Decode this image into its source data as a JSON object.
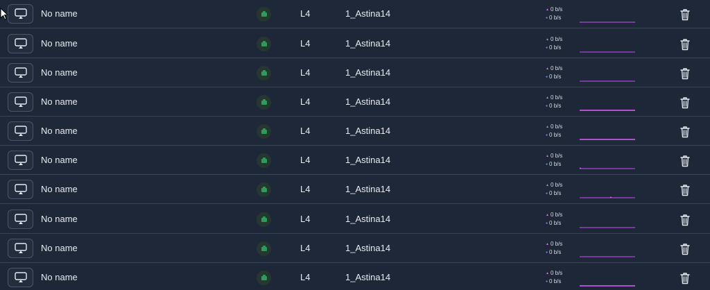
{
  "colors": {
    "background": "#1f2838",
    "row_divider": "#384356",
    "status_online": "#2f9a5e",
    "upload_accent": "#d070e8",
    "download_accent": "#7b8bf0",
    "sparkline": "#c84dff"
  },
  "icons": {
    "device": "airplay-icon",
    "status": "router-icon",
    "delete": "trash-icon",
    "pointer": "mouse-cursor-icon"
  },
  "rows": [
    {
      "name": "No name",
      "level": "L4",
      "host": "1_Astina14",
      "up": "0 b/s",
      "down": "0 b/s"
    },
    {
      "name": "No name",
      "level": "L4",
      "host": "1_Astina14",
      "up": "0 b/s",
      "down": "0 b/s"
    },
    {
      "name": "No name",
      "level": "L4",
      "host": "1_Astina14",
      "up": "0 b/s",
      "down": "0 b/s"
    },
    {
      "name": "No name",
      "level": "L4",
      "host": "1_Astina14",
      "up": "0 b/s",
      "down": "0 b/s"
    },
    {
      "name": "No name",
      "level": "L4",
      "host": "1_Astina14",
      "up": "0 b/s",
      "down": "0 b/s"
    },
    {
      "name": "No name",
      "level": "L4",
      "host": "1_Astina14",
      "up": "0 b/s",
      "down": "0 b/s"
    },
    {
      "name": "No name",
      "level": "L4",
      "host": "1_Astina14",
      "up": "0 b/s",
      "down": "0 b/s"
    },
    {
      "name": "No name",
      "level": "L4",
      "host": "1_Astina14",
      "up": "0 b/s",
      "down": "0 b/s"
    },
    {
      "name": "No name",
      "level": "L4",
      "host": "1_Astina14",
      "up": "0 b/s",
      "down": "0 b/s"
    },
    {
      "name": "No name",
      "level": "L4",
      "host": "1_Astina14",
      "up": "0 b/s",
      "down": "0 b/s"
    }
  ]
}
